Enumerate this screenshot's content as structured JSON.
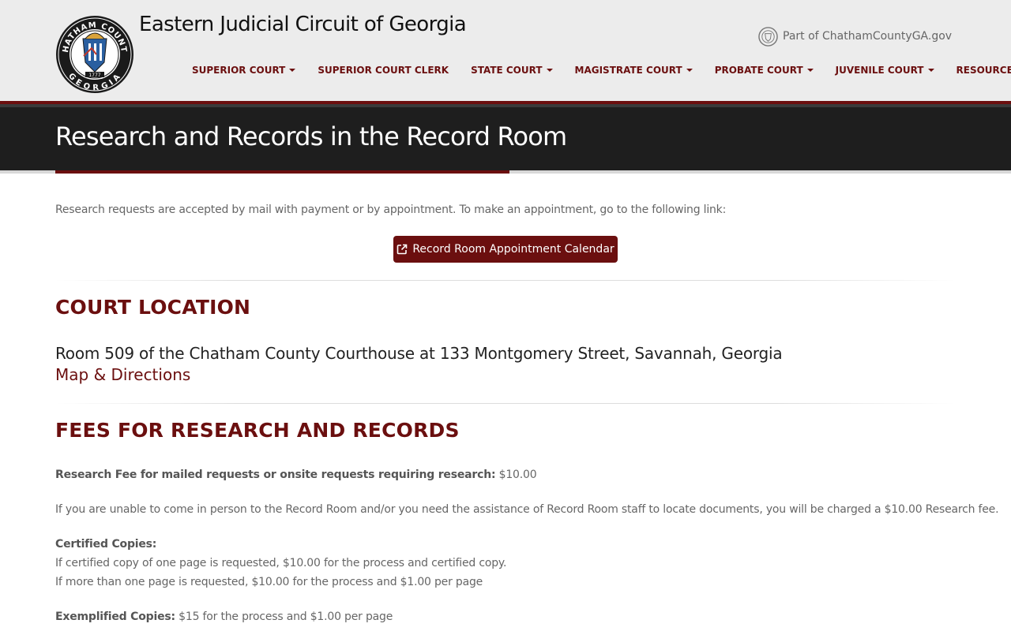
{
  "header": {
    "site_title": "Eastern Judicial Circuit of Georgia",
    "part_of": "Part of ChathamCountyGA.gov",
    "logo": {
      "top_text": "CHATHAM COUNTY",
      "bottom_text": "GEORGIA",
      "year": "1777"
    },
    "nav": [
      {
        "label": "SUPERIOR COURT",
        "dropdown": true
      },
      {
        "label": "SUPERIOR COURT CLERK",
        "dropdown": false
      },
      {
        "label": "STATE COURT",
        "dropdown": true
      },
      {
        "label": "MAGISTRATE COURT",
        "dropdown": true
      },
      {
        "label": "PROBATE COURT",
        "dropdown": true
      },
      {
        "label": "JUVENILE COURT",
        "dropdown": true
      },
      {
        "label": "RESOURCES",
        "dropdown": true
      }
    ]
  },
  "banner": {
    "title": "Research and Records in the Record Room"
  },
  "intro": {
    "text": "Research requests are accepted by mail with payment or by appointment. To make an appointment, go to the following link:",
    "button_label": "Record Room Appointment Calendar",
    "button_icon": "external-link-icon"
  },
  "location": {
    "heading_normal": "COURT ",
    "heading_bold": "LOCATION",
    "address": "Room 509 of the Chatham County Courthouse at 133 Montgomery Street, Savannah, Georgia",
    "map_link": "Map & Directions"
  },
  "fees": {
    "heading_bold": "FEES",
    "heading_normal": " FOR RESEARCH AND RECORDS",
    "research_label": "Research Fee for mailed requests or onsite requests requiring research:",
    "research_value": " $10.00",
    "research_note": "If you are unable to come in person to the Record Room and/or you need the assistance of Record Room staff to locate documents, you will be charged a $10.00 Research fee.",
    "certified_label": "Certified Copies:",
    "certified_one": "If certified copy of one page is requested, $10.00 for the process and certified copy.",
    "certified_more": "If more than one page is requested, $10.00 for the process and $1.00 per page",
    "exemplified_label": "Exemplified Copies:",
    "exemplified_value": " $15 for the process and $1.00 per page"
  },
  "colors": {
    "brand_maroon": "#6b0f0f",
    "banner_dark": "#1e1e1e",
    "header_bg": "#ececec"
  }
}
